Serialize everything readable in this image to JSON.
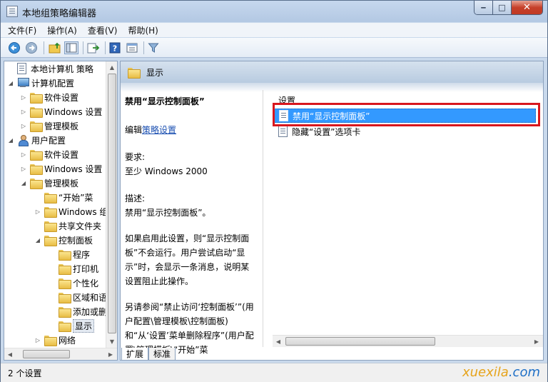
{
  "window": {
    "title": "本地组策略编辑器",
    "minimize": "‒",
    "maximize": "□",
    "close": "✕"
  },
  "menu": [
    "文件(F)",
    "操作(A)",
    "查看(V)",
    "帮助(H)"
  ],
  "toolbar": [
    "back-icon",
    "forward-icon",
    "up-folder-icon",
    "show-tree-icon",
    "export-icon",
    "help-icon",
    "view-icon",
    "filter-icon"
  ],
  "tree": [
    {
      "label": "本地计算机 策略",
      "indent": 0,
      "icon": "doc",
      "twisty": ""
    },
    {
      "label": "计算机配置",
      "indent": 0,
      "icon": "computer",
      "twisty": "◢"
    },
    {
      "label": "软件设置",
      "indent": 1,
      "icon": "folder",
      "twisty": "▷"
    },
    {
      "label": "Windows 设置",
      "indent": 1,
      "icon": "folder",
      "twisty": "▷"
    },
    {
      "label": "管理模板",
      "indent": 1,
      "icon": "folder",
      "twisty": "▷"
    },
    {
      "label": "用户配置",
      "indent": 0,
      "icon": "user",
      "twisty": "◢"
    },
    {
      "label": "软件设置",
      "indent": 1,
      "icon": "folder",
      "twisty": "▷"
    },
    {
      "label": "Windows 设置",
      "indent": 1,
      "icon": "folder",
      "twisty": "▷"
    },
    {
      "label": "管理模板",
      "indent": 1,
      "icon": "folder",
      "twisty": "◢"
    },
    {
      "label": "“开始”菜",
      "indent": 2,
      "icon": "folder",
      "twisty": ""
    },
    {
      "label": "Windows 组",
      "indent": 2,
      "icon": "folder",
      "twisty": "▷"
    },
    {
      "label": "共享文件夹",
      "indent": 2,
      "icon": "folder",
      "twisty": ""
    },
    {
      "label": "控制面板",
      "indent": 2,
      "icon": "folder",
      "twisty": "◢"
    },
    {
      "label": "程序",
      "indent": 3,
      "icon": "folder",
      "twisty": ""
    },
    {
      "label": "打印机",
      "indent": 3,
      "icon": "folder",
      "twisty": ""
    },
    {
      "label": "个性化",
      "indent": 3,
      "icon": "folder",
      "twisty": ""
    },
    {
      "label": "区域和语",
      "indent": 3,
      "icon": "folder",
      "twisty": ""
    },
    {
      "label": "添加或删",
      "indent": 3,
      "icon": "folder",
      "twisty": ""
    },
    {
      "label": "显示",
      "indent": 3,
      "icon": "folder",
      "twisty": "",
      "selected": true
    },
    {
      "label": "网络",
      "indent": 2,
      "icon": "folder",
      "twisty": "▷"
    }
  ],
  "right": {
    "header": "显示",
    "desc": {
      "title": "禁用“显示控制面板”",
      "edit_prefix": "编辑",
      "edit_link": "策略设置",
      "req_label": "要求:",
      "req_value": "至少 Windows 2000",
      "desc_label": "描述:",
      "desc_value": "禁用“显示控制面板”。",
      "para1": "如果启用此设置，则“显示控制面板”不会运行。用户尝试启动“显示”时，会显示一条消息，说明某设置阻止此操作。",
      "para2": "另请参阅“禁止访问‘控制面板’”(用户配置\\管理模板\\控制面板)和“从‘设置’菜单删除程序”(用户配置\\管理模板\\“开始”菜"
    },
    "list_header": "设置",
    "list": [
      {
        "label": "禁用“显示控制面板”",
        "selected": true
      },
      {
        "label": "隐藏“设置”选项卡",
        "selected": false
      }
    ],
    "tabs": [
      "扩展",
      "标准"
    ]
  },
  "status": "2 个设置",
  "watermark": {
    "part1": "xuexila",
    "part2": ".com"
  }
}
